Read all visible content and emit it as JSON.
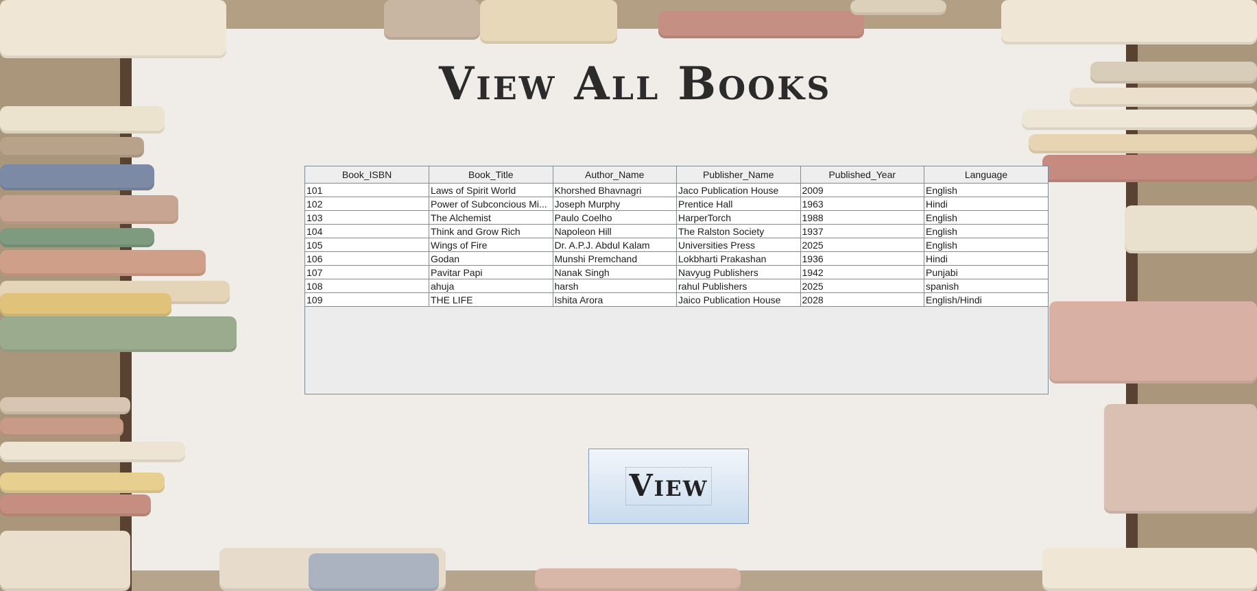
{
  "page": {
    "title": "View All Books"
  },
  "books_table": {
    "columns": [
      "Book_ISBN",
      "Book_Title",
      "Author_Name",
      "Publisher_Name",
      "Published_Year",
      "Language"
    ],
    "rows": [
      [
        "101",
        "Laws of Spirit World",
        "Khorshed Bhavnagri",
        "Jaco Publication House",
        "2009",
        "English"
      ],
      [
        "102",
        "Power of Subconcious Mi...",
        "Joseph Murphy",
        "Prentice Hall",
        "1963",
        "Hindi"
      ],
      [
        "103",
        "The Alchemist",
        "Paulo Coelho",
        "HarperTorch",
        "1988",
        "English"
      ],
      [
        "104",
        "Think and Grow Rich",
        "Napoleon Hill",
        "The Ralston Society",
        "1937",
        "English"
      ],
      [
        "105",
        "Wings of Fire",
        "Dr. A.P.J. Abdul Kalam",
        "Universities Press",
        "2025",
        "English"
      ],
      [
        "106",
        "Godan",
        "Munshi Premchand",
        "Lokbharti Prakashan",
        "1936",
        "Hindi"
      ],
      [
        "107",
        "Pavitar Papi",
        "Nanak Singh",
        "Navyug Publishers",
        "1942",
        "Punjabi"
      ],
      [
        "108",
        "ahuja",
        "harsh",
        "rahul Publishers",
        "2025",
        "spanish"
      ],
      [
        "109",
        "THE LIFE",
        "Ishita Arora",
        "Jaico Publication House",
        "2028",
        "English/Hindi"
      ]
    ]
  },
  "actions": {
    "view_label": "View"
  },
  "colors": {
    "background": "#efebe5",
    "title_text": "#2b2b2b",
    "grid_line": "#7a8a99",
    "button_top": "#f2f6fb",
    "button_bottom": "#c9dbee"
  }
}
